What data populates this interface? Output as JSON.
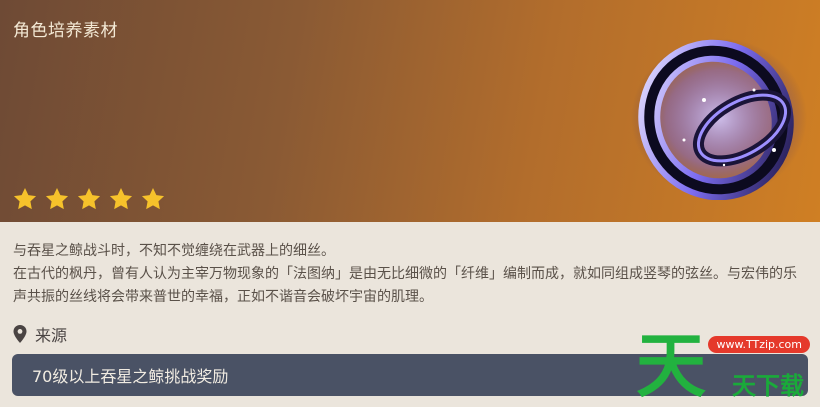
{
  "header": {
    "title": "角色培养素材",
    "rarity_stars": 5,
    "star_color": "#f6c22b",
    "background_gradient": [
      "#6e4a35",
      "#cf7f24"
    ]
  },
  "item": {
    "icon": "cosmic-string-icon",
    "description_lines": [
      "与吞星之鲸战斗时，不知不觉缠绕在武器上的细丝。",
      "在古代的枫丹，曾有人认为主宰万物现象的「法图纳」是由无比细微的「纤维」编制而成，就如同组成竖琴的弦丝。与宏伟的乐声共振的丝线将会带来普世的幸福，正如不谐音会破坏宇宙的肌理。"
    ]
  },
  "source": {
    "label": "来源",
    "icon": "location-pin-icon",
    "entries": [
      "70级以上吞星之鲸挑战奖励"
    ]
  },
  "watermark": {
    "bubble_text": "www.TTzip.com",
    "big_char": "天",
    "text": "天下载"
  }
}
